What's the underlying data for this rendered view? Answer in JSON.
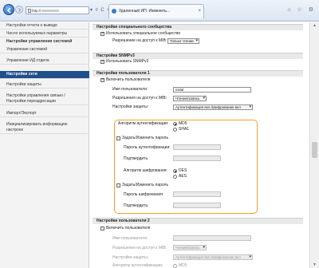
{
  "browser": {
    "address": "http://",
    "tab_title": "Удаленный ИП: Изменить...",
    "tab_close": "×",
    "addr_icons": "▾ ◊ C ×",
    "toolbar_icons": "⌂ ☆ ⚙"
  },
  "sidebar": {
    "items": [
      {
        "label": "Настройки отчета о выводе"
      },
      {
        "label": "Число используемых параметры"
      },
      {
        "label": "Настройки управления системой"
      },
      {
        "label": "Управление системой"
      },
      {
        "label": "Управление ИД отдела"
      },
      {
        "label": "Настройки сети"
      },
      {
        "label": "Настройки защиты"
      },
      {
        "label": "Настройки управления связью /"
      },
      {
        "label": "Настройки переадресации"
      },
      {
        "label": "Импорт/Экспорт"
      },
      {
        "label": "Инициализировать информацию"
      },
      {
        "label": "настроек"
      }
    ]
  },
  "community": {
    "header": "Настройки специального сообщества",
    "use_label": "Использовать специальное сообщество",
    "access_label": "Разрешение на доступ к MIB:",
    "access_value": "Только чтение"
  },
  "snmpv3": {
    "header": "Настройки SNMPv3",
    "use_label": "Использовать SNMPv3"
  },
  "user1": {
    "header": "Настройки пользователя 1",
    "enable_label": "Включить пользователя",
    "username_label": "Имя пользователя:",
    "username_value": "initial",
    "mib_label": "Разрешения на доступ к MIB:",
    "mib_value": "Чтение/запись",
    "security_label": "Настройки защиты:",
    "security_value": "Аутентификация вкл./Шифрование вкл",
    "auth_algo_label": "Алгоритм аутентификации:",
    "auth_md5": "MD5",
    "auth_sha1": "SHA1",
    "set_auth_pw_label": "Задать/Изменить пароль",
    "auth_pw_label": "Пароль аутентификации:",
    "auth_confirm_label": "Подтвердить:",
    "enc_algo_label": "Алгоритм шифрования:",
    "enc_des": "DES",
    "enc_aes": "AES",
    "set_enc_pw_label": "Задать/Изменить пароль",
    "enc_pw_label": "Пароль шифрования:",
    "enc_confirm_label": "Подтвердить:"
  },
  "user2": {
    "header": "Настройки пользователя 2",
    "enable_label": "Включить пользователя",
    "username_label": "Имя пользователя:",
    "mib_label": "Разрешения на доступ к MIB:",
    "mib_value": "Чтение/запись",
    "security_label": "Настройки защиты:",
    "security_value": "Аутентификация вкл./Шифрование вкл",
    "auth_algo_label": "Алгоритм аутентификации:",
    "auth_md5": "MD5"
  },
  "scroll": {
    "up": "▲",
    "down": "▼"
  }
}
